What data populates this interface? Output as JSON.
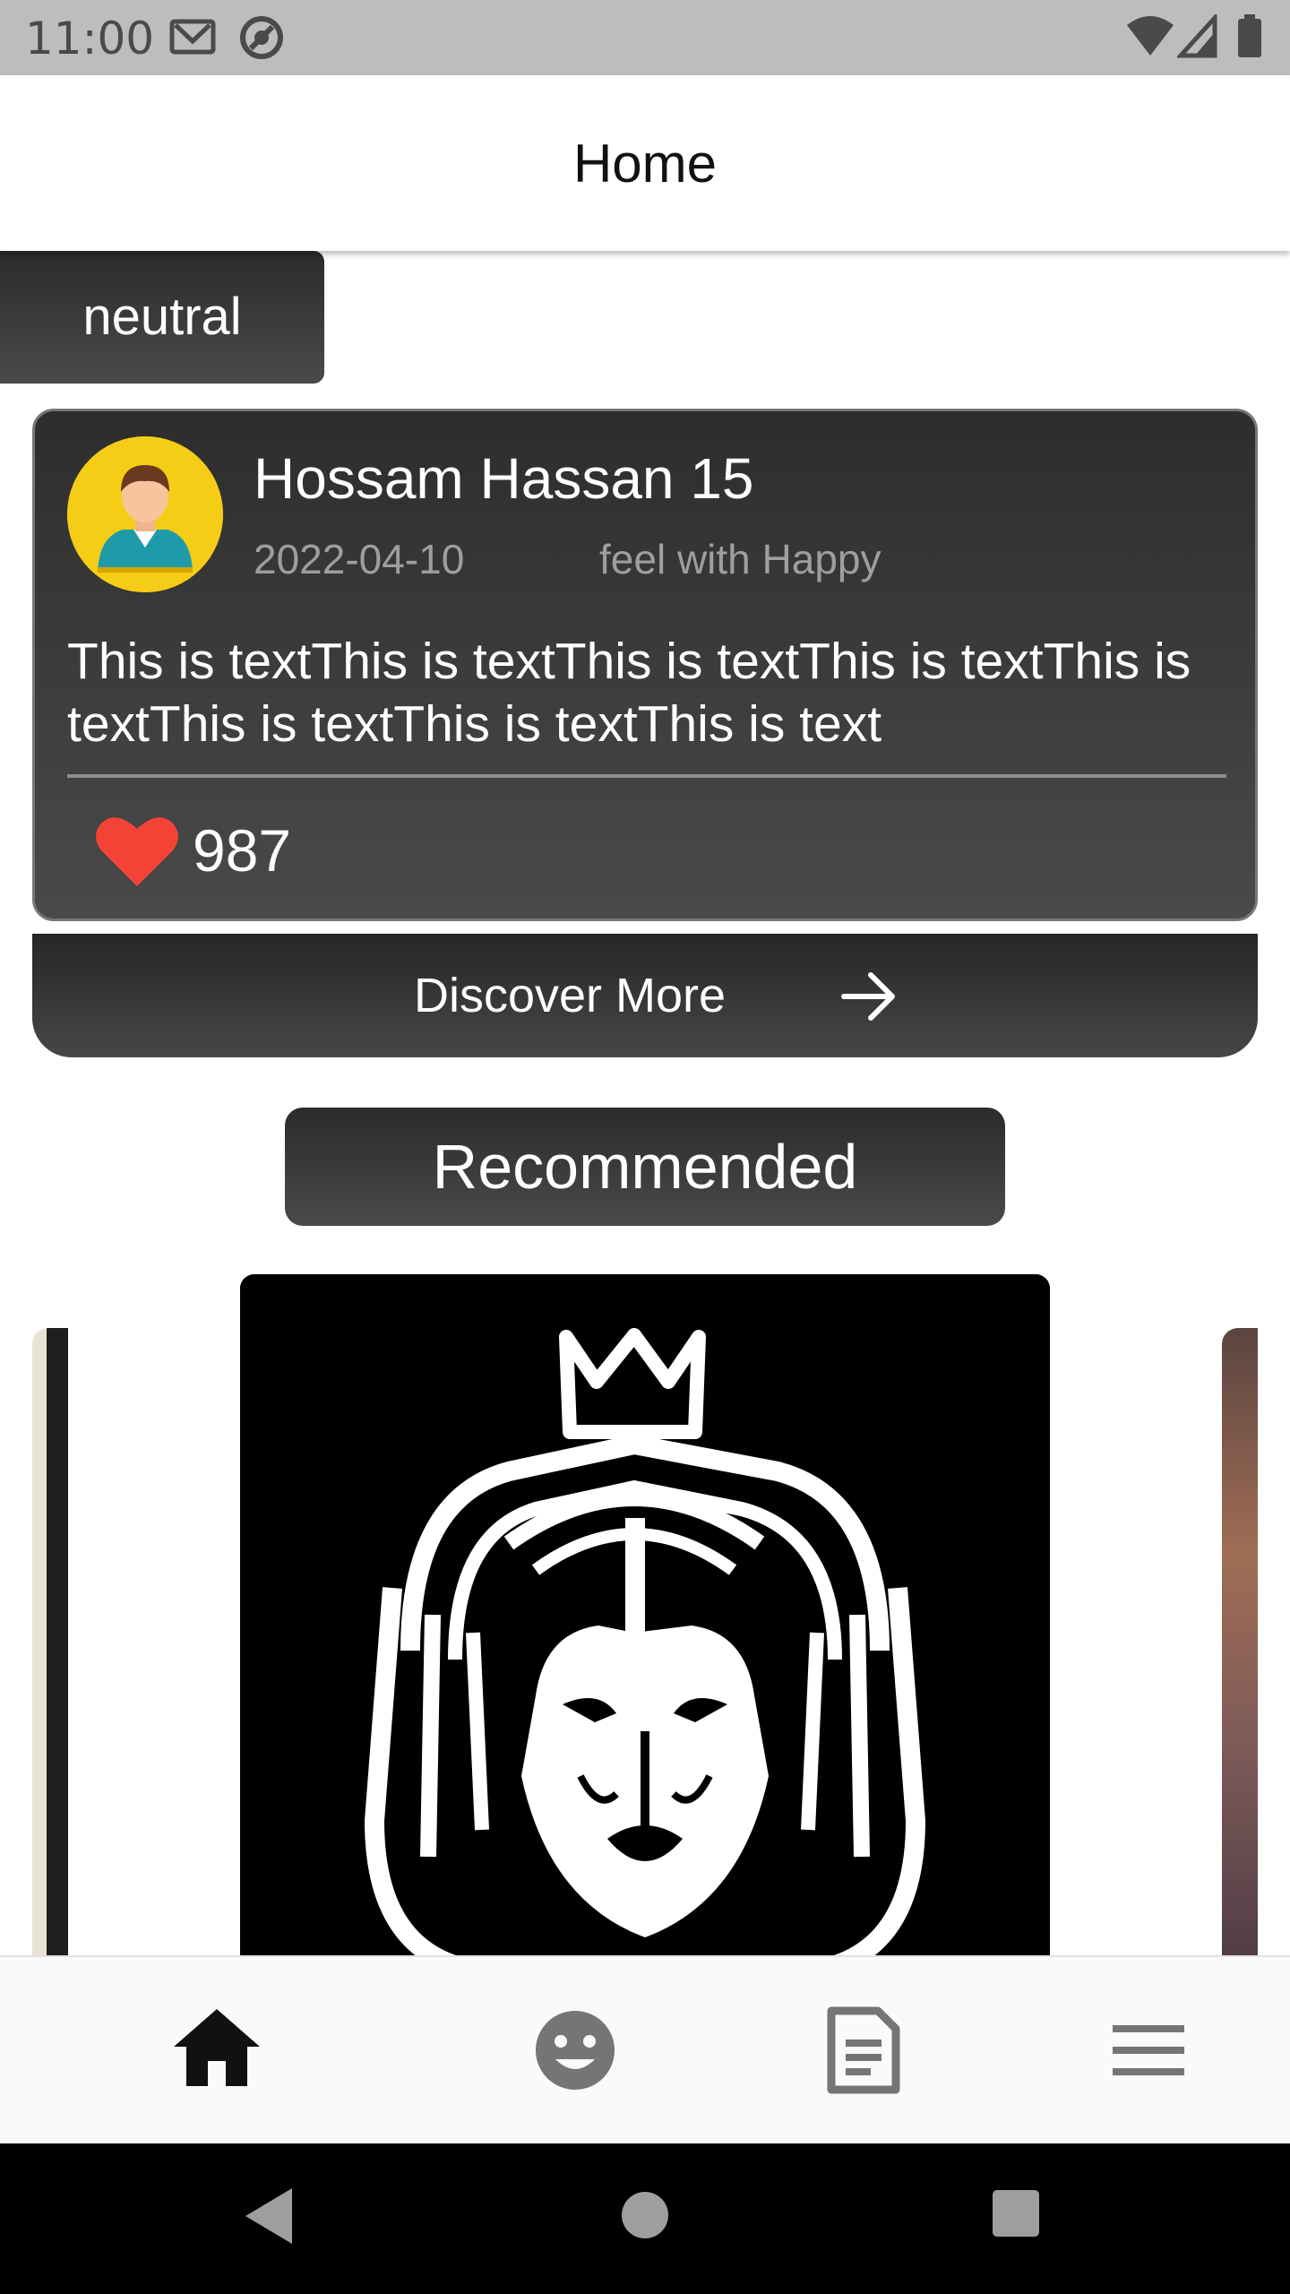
{
  "status_bar": {
    "time": "11:00",
    "icons": [
      "gmail-icon",
      "sync-icon",
      "wifi-icon",
      "signal-icon",
      "battery-icon"
    ]
  },
  "header": {
    "title": "Home"
  },
  "mood_chip": {
    "label": "neutral"
  },
  "post": {
    "author": "Hossam Hassan 15",
    "date": "2022-04-10",
    "feeling": "feel with Happy",
    "body": "This is textThis is textThis is textThis is textThis is textThis is textThis is textThis is text",
    "likes": "987"
  },
  "discover": {
    "label": "Discover More"
  },
  "recommended": {
    "label": "Recommended"
  },
  "bottom_nav": {
    "items": [
      {
        "icon": "home-icon",
        "active": true
      },
      {
        "icon": "mood-icon",
        "active": false
      },
      {
        "icon": "article-icon",
        "active": false
      },
      {
        "icon": "menu-icon",
        "active": false
      }
    ]
  },
  "system_nav": [
    "back-icon",
    "home-circle-icon",
    "recents-icon"
  ],
  "colors": {
    "accent_dark": "#3a3a3a",
    "heart": "#f44336",
    "avatar_bg": "#f6cd16"
  }
}
